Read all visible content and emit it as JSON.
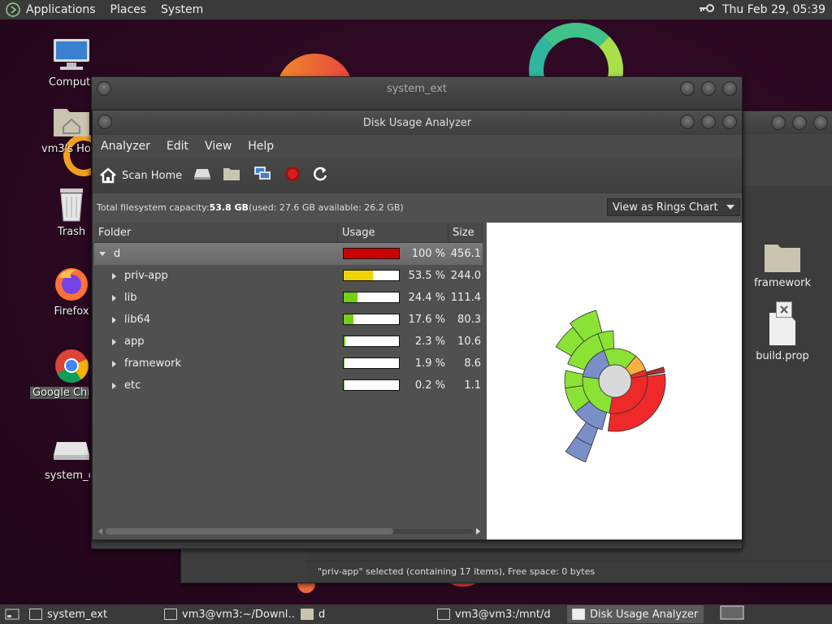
{
  "top_panel": {
    "menus": [
      "Applications",
      "Places",
      "System"
    ],
    "clock": "Thu Feb 29, 05:39"
  },
  "desktop_icons": [
    {
      "label": "Computer",
      "icon": "computer-icon"
    },
    {
      "label": "vm3's Home",
      "icon": "home-folder-icon"
    },
    {
      "label": "Trash",
      "icon": "trash-icon"
    },
    {
      "label": "Firefox",
      "icon": "firefox-icon"
    },
    {
      "label": "Google Chrome",
      "icon": "chrome-icon"
    },
    {
      "label": "system_ext",
      "icon": "drive-icon"
    }
  ],
  "bg_window_title": "system_ext",
  "file_manager": {
    "items": [
      {
        "label": "framework",
        "icon": "folder-icon"
      },
      {
        "label": "build.prop",
        "icon": "file-icon"
      }
    ],
    "status": "\"priv-app\" selected (containing 17 items), Free space: 0 bytes"
  },
  "analyzer": {
    "title": "Disk Usage Analyzer",
    "menus": [
      "Analyzer",
      "Edit",
      "View",
      "Help"
    ],
    "toolbar": {
      "scan_home": "Scan Home"
    },
    "info_prefix": "Total filesystem capacity: ",
    "info_capacity": "53.8 GB",
    "info_rest": " (used: 27.6 GB available: 26.2 GB)",
    "view_mode": "View as Rings Chart",
    "columns": {
      "folder": "Folder",
      "usage": "Usage",
      "size": "Size"
    },
    "rows": [
      {
        "name": "d",
        "pct": "100 %",
        "size": "456.1",
        "fill": 1.0,
        "color": "#cc0000",
        "expanded": true
      },
      {
        "name": "priv-app",
        "pct": "53.5 %",
        "size": "244.0",
        "fill": 0.535,
        "color": "#edd400",
        "expanded": false
      },
      {
        "name": "lib",
        "pct": "24.4 %",
        "size": "111.4",
        "fill": 0.244,
        "color": "#73d216",
        "expanded": false
      },
      {
        "name": "lib64",
        "pct": "17.6 %",
        "size": "80.3",
        "fill": 0.176,
        "color": "#73d216",
        "expanded": false
      },
      {
        "name": "app",
        "pct": "2.3 %",
        "size": "10.6",
        "fill": 0.023,
        "color": "#73d216",
        "expanded": false
      },
      {
        "name": "framework",
        "pct": "1.9 %",
        "size": "8.6",
        "fill": 0.019,
        "color": "#73d216",
        "expanded": false
      },
      {
        "name": "etc",
        "pct": "0.2 %",
        "size": "1.1",
        "fill": 0.002,
        "color": "#73d216",
        "expanded": false
      }
    ]
  },
  "taskbar": [
    {
      "label": "system_ext",
      "icon": "window-icon",
      "active": false
    },
    {
      "label": "vm3@vm3:~/Downl…",
      "icon": "terminal-icon",
      "active": false
    },
    {
      "label": "d",
      "icon": "folder-icon",
      "active": false
    },
    {
      "label": "vm3@vm3:/mnt/d",
      "icon": "terminal-icon",
      "active": false
    },
    {
      "label": "Disk Usage Analyzer",
      "icon": "disk-usage-icon",
      "active": true
    }
  ],
  "colors": {
    "red": "#ef2929",
    "green": "#8ae234",
    "orange": "#fcaf3e",
    "blue": "#7a8fc8",
    "yellow": "#edd400"
  }
}
